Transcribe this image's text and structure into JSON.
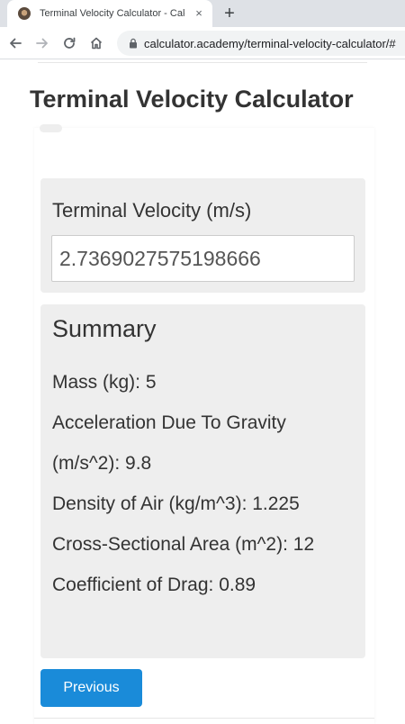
{
  "browser": {
    "tab_title": "Terminal Velocity Calculator - Calculator Academy",
    "tab_close": "×",
    "new_tab": "+",
    "url": "calculator.academy/terminal-velocity-calculator/#"
  },
  "page": {
    "title": "Terminal Velocity Calculator"
  },
  "result": {
    "label": "Terminal Velocity (m/s)",
    "value": "2.7369027575198666"
  },
  "summary": {
    "title": "Summary",
    "items": [
      {
        "label": "Mass (kg): 5"
      },
      {
        "label": "Acceleration Due To Gravity (m/s^2): 9.8"
      },
      {
        "label": "Density of Air (kg/m^3): 1.225"
      },
      {
        "label": "Cross-Sectional Area (m^2): 12"
      },
      {
        "label": "Coefficient of Drag: 0.89"
      }
    ]
  },
  "actions": {
    "previous_label": "Previous"
  },
  "icons": {
    "back": "arrow-left-icon",
    "forward": "arrow-right-icon",
    "reload": "reload-icon",
    "home": "home-icon",
    "lock": "lock-icon",
    "favicon": "site-favicon-icon"
  },
  "colors": {
    "button": "#1a8bd9",
    "panel": "#eeeeee",
    "text": "#333333"
  }
}
